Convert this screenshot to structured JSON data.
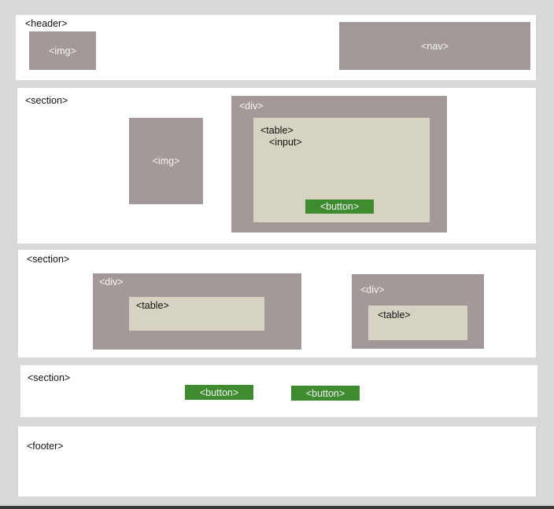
{
  "header": {
    "tag": "<header>",
    "img": "<img>",
    "nav": "<nav>"
  },
  "section1": {
    "tag": "<section>",
    "img": "<img>",
    "div": "<div>",
    "table": "<table>",
    "input": "<input>",
    "button": "<button>"
  },
  "section2": {
    "tag": "<section>",
    "div1": "<div>",
    "table1": "<table>",
    "div2": "<div>",
    "table2": "<table>"
  },
  "section3": {
    "tag": "<section>",
    "button1": "<button>",
    "button2": "<button>"
  },
  "footer": {
    "tag": "<footer>"
  },
  "colors": {
    "background": "#d9d9d9",
    "panel": "#ffffff",
    "block": "#a39999",
    "table": "#d6d3c2",
    "button": "#3e8b30"
  }
}
